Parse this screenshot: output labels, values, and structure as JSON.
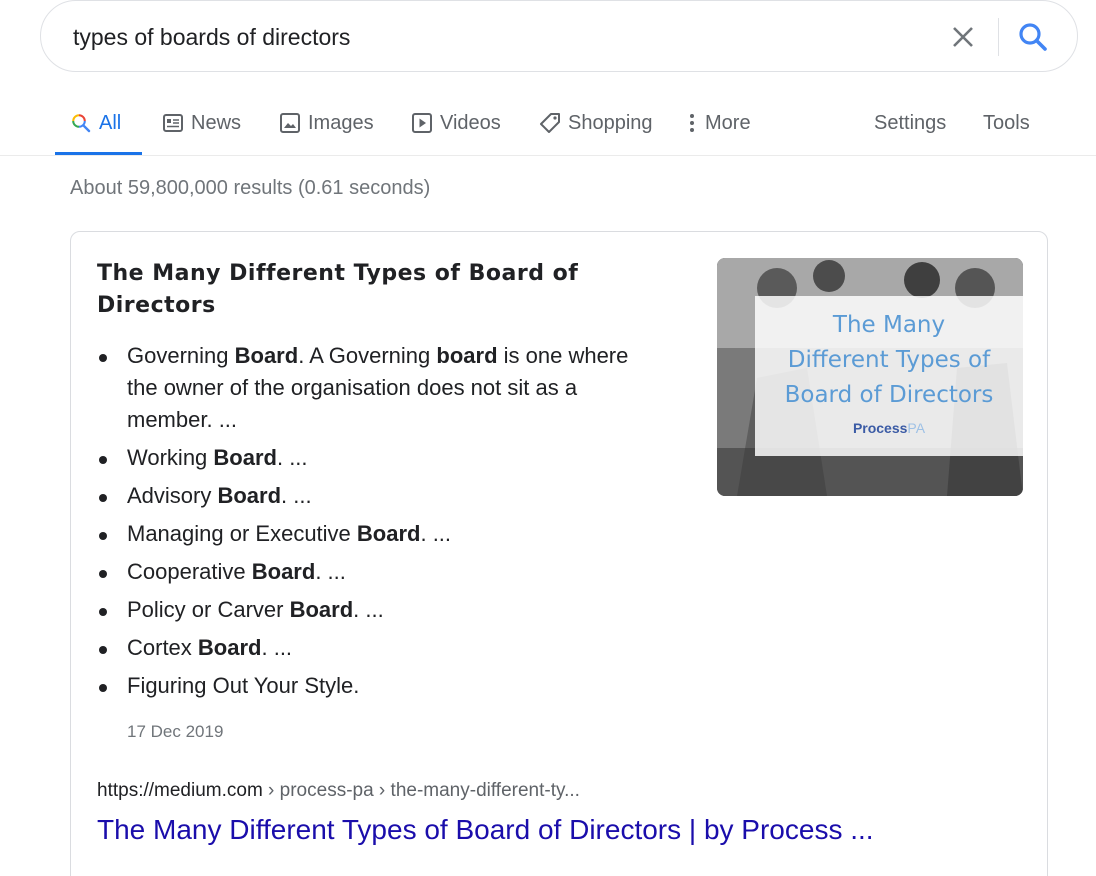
{
  "search": {
    "query": "types of boards of directors"
  },
  "tabs": [
    {
      "label": "All",
      "icon": "search-icon"
    },
    {
      "label": "News",
      "icon": "news-icon"
    },
    {
      "label": "Images",
      "icon": "image-icon"
    },
    {
      "label": "Videos",
      "icon": "play-icon"
    },
    {
      "label": "Shopping",
      "icon": "tag-icon"
    },
    {
      "label": "More",
      "icon": "more-vert-icon"
    }
  ],
  "tools": {
    "settings": "Settings",
    "tools": "Tools"
  },
  "stats": "About 59,800,000 results (0.61 seconds)",
  "snippet": {
    "title": "The Many Different Types of Board of Directors",
    "items": [
      {
        "pre": "Governing ",
        "bold": "Board",
        "post": ". A Governing ",
        "bold2": "board",
        "post2": " is one where the owner of the organisation does not sit as a member. ..."
      },
      {
        "pre": "Working ",
        "bold": "Board",
        "post": ". ..."
      },
      {
        "pre": "Advisory ",
        "bold": "Board",
        "post": ". ..."
      },
      {
        "pre": "Managing or Executive ",
        "bold": "Board",
        "post": ". ..."
      },
      {
        "pre": "Cooperative ",
        "bold": "Board",
        "post": ". ..."
      },
      {
        "pre": "Policy or Carver ",
        "bold": "Board",
        "post": ". ..."
      },
      {
        "pre": "Cortex ",
        "bold": "Board",
        "post": ". ..."
      },
      {
        "pre": "Figuring Out Your Style.",
        "bold": "",
        "post": ""
      }
    ],
    "date": "17 Dec 2019",
    "image": {
      "lines": [
        "The Many",
        "Different Types of",
        "Board of Directors"
      ],
      "logo_main": "Process",
      "logo_suffix": "PA"
    },
    "url": {
      "domain": "https://medium.com",
      "path": " › process-pa › the-many-different-ty..."
    },
    "link": "The Many Different Types of Board of Directors | by Process ..."
  },
  "colors": {
    "accent": "#1a73e8",
    "link": "#1a0dab",
    "muted": "#70757a"
  }
}
